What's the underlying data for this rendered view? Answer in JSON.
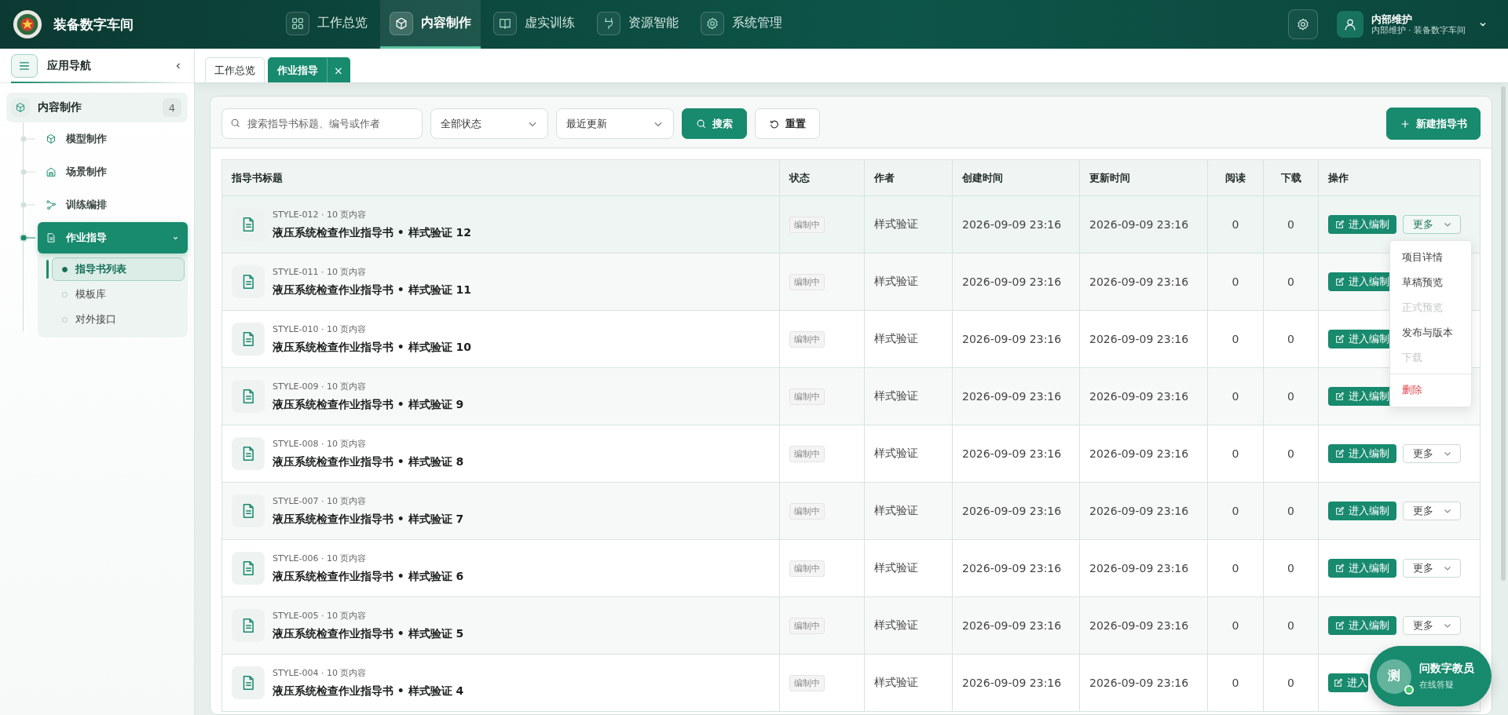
{
  "app": {
    "title": "装备数字车间"
  },
  "nav": [
    {
      "label": "工作总览",
      "selected": false
    },
    {
      "label": "内容制作",
      "selected": true
    },
    {
      "label": "虚实训练",
      "selected": false
    },
    {
      "label": "资源智能",
      "selected": false
    },
    {
      "label": "系统管理",
      "selected": false
    }
  ],
  "user": {
    "name": "内部维护",
    "subtitle": "内部维护 · 装备数字车间"
  },
  "sidebar": {
    "title": "应用导航",
    "section": {
      "label": "内容制作",
      "count": "4",
      "children": [
        {
          "label": "模型制作",
          "selected": false
        },
        {
          "label": "场景制作",
          "selected": false
        },
        {
          "label": "训练编排",
          "selected": false
        },
        {
          "label": "作业指导",
          "selected": true,
          "expanded": true,
          "children": [
            {
              "label": "指导书列表",
              "selected": true
            },
            {
              "label": "模板库",
              "selected": false
            },
            {
              "label": "对外接口",
              "selected": false
            }
          ]
        }
      ]
    }
  },
  "tabs": [
    {
      "label": "工作总览",
      "selected": false
    },
    {
      "label": "作业指导",
      "selected": true,
      "close": "×"
    }
  ],
  "toolbar": {
    "search": {
      "placeholder": "搜索指导书标题、编号或作者"
    },
    "status_select": "全部状态",
    "sort_select": "最近更新",
    "search_button": "搜索",
    "reset_button": "重置",
    "new_button": "新建指导书"
  },
  "table": {
    "columns": [
      "指导书标题",
      "状态",
      "作者",
      "创建时间",
      "更新时间",
      "阅读",
      "下载",
      "操作"
    ],
    "rows": [
      {
        "meta": "STYLE-012 · 10 页内容",
        "title": "液压系统检查作业指导书 • 样式验证 12",
        "status": "编制中",
        "author": "样式验证",
        "created": "2026-09-09 23:16",
        "updated": "2026-09-09 23:16",
        "reads": "0",
        "downloads": "0",
        "edit": "进入编制",
        "more": "更多",
        "selected": true
      },
      {
        "meta": "STYLE-011 · 10 页内容",
        "title": "液压系统检查作业指导书 • 样式验证 11",
        "status": "编制中",
        "author": "样式验证",
        "created": "2026-09-09 23:16",
        "updated": "2026-09-09 23:16",
        "reads": "0",
        "downloads": "0",
        "edit": "进入编制",
        "selected": false
      },
      {
        "meta": "STYLE-010 · 10 页内容",
        "title": "液压系统检查作业指导书 • 样式验证 10",
        "status": "编制中",
        "author": "样式验证",
        "created": "2026-09-09 23:16",
        "updated": "2026-09-09 23:16",
        "reads": "0",
        "downloads": "0",
        "edit": "进入编制",
        "selected": false
      },
      {
        "meta": "STYLE-009 · 10 页内容",
        "title": "液压系统检查作业指导书 • 样式验证 9",
        "status": "编制中",
        "author": "样式验证",
        "created": "2026-09-09 23:16",
        "updated": "2026-09-09 23:16",
        "reads": "0",
        "downloads": "0",
        "edit": "进入编制",
        "selected": false
      },
      {
        "meta": "STYLE-008 · 10 页内容",
        "title": "液压系统检查作业指导书 • 样式验证 8",
        "status": "编制中",
        "author": "样式验证",
        "created": "2026-09-09 23:16",
        "updated": "2026-09-09 23:16",
        "reads": "0",
        "downloads": "0",
        "edit": "进入编制",
        "more": "更多",
        "selected": false
      },
      {
        "meta": "STYLE-007 · 10 页内容",
        "title": "液压系统检查作业指导书 • 样式验证 7",
        "status": "编制中",
        "author": "样式验证",
        "created": "2026-09-09 23:16",
        "updated": "2026-09-09 23:16",
        "reads": "0",
        "downloads": "0",
        "edit": "进入编制",
        "more": "更多",
        "selected": false
      },
      {
        "meta": "STYLE-006 · 10 页内容",
        "title": "液压系统检查作业指导书 • 样式验证 6",
        "status": "编制中",
        "author": "样式验证",
        "created": "2026-09-09 23:16",
        "updated": "2026-09-09 23:16",
        "reads": "0",
        "downloads": "0",
        "edit": "进入编制",
        "more": "更多",
        "selected": false
      },
      {
        "meta": "STYLE-005 · 10 页内容",
        "title": "液压系统检查作业指导书 • 样式验证 5",
        "status": "编制中",
        "author": "样式验证",
        "created": "2026-09-09 23:16",
        "updated": "2026-09-09 23:16",
        "reads": "0",
        "downloads": "0",
        "edit": "进入编制",
        "more": "更多",
        "selected": false
      },
      {
        "meta": "STYLE-004 · 10 页内容",
        "title": "液压系统检查作业指导书 • 样式验证 4",
        "status": "编制中",
        "author": "样式验证",
        "created": "2026-09-09 23:16",
        "updated": "2026-09-09 23:16",
        "reads": "0",
        "downloads": "0",
        "edit": "进入",
        "selected": false
      }
    ]
  },
  "more_menu": [
    {
      "label": "项目详情",
      "kind": "item",
      "disabled": false
    },
    {
      "label": "草稿预览",
      "kind": "item",
      "disabled": false
    },
    {
      "label": "正式预览",
      "kind": "item",
      "disabled": true
    },
    {
      "label": "发布与版本",
      "kind": "item",
      "disabled": false
    },
    {
      "label": "下载",
      "kind": "item",
      "disabled": true
    },
    {
      "label": "删除",
      "kind": "danger",
      "disabled": false
    }
  ],
  "assistant": {
    "avatar": "测",
    "title": "问数字教员",
    "subtitle": "在线答疑"
  }
}
